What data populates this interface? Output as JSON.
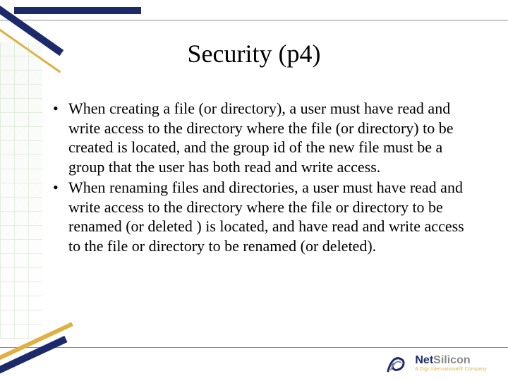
{
  "title": "Security (p4)",
  "bullets": [
    "When creating a file (or directory), a user must have read and write access to the directory where the file (or directory) to be created is located, and the group id of the new file must be a group that the user has both read and write access.",
    "When renaming files and directories, a user must have read and write access to the directory where the file or directory to be renamed (or deleted ) is located, and have read and write access to the file or directory to be renamed (or deleted)."
  ],
  "logo": {
    "name_prefix": "Net",
    "name_suffix": "Silicon",
    "tagline": "A Digi International® Company"
  }
}
